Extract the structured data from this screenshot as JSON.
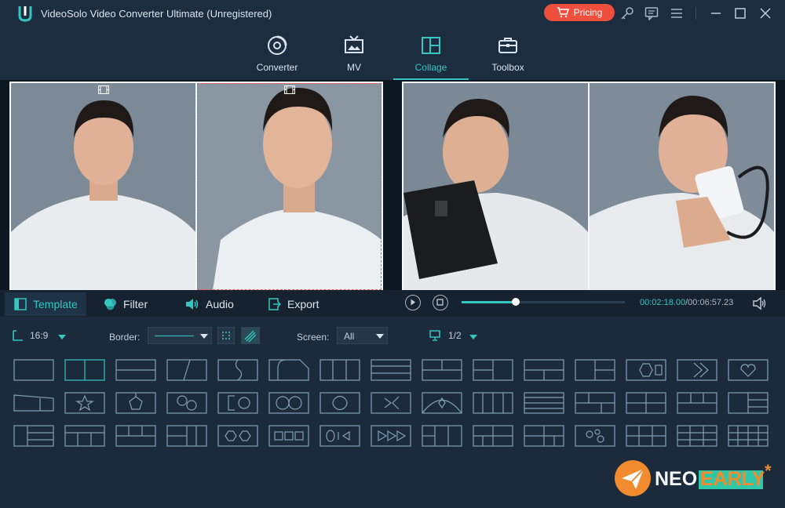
{
  "app": {
    "title": "VideoSolo Video Converter Ultimate (Unregistered)",
    "pricing_label": "Pricing"
  },
  "tabs": [
    {
      "label": "Converter",
      "icon": "converter-icon"
    },
    {
      "label": "MV",
      "icon": "mv-icon"
    },
    {
      "label": "Collage",
      "icon": "collage-icon",
      "active": true
    },
    {
      "label": "Toolbox",
      "icon": "toolbox-icon"
    }
  ],
  "controls": {
    "tabs": [
      {
        "label": "Template",
        "icon": "template-icon",
        "active": true
      },
      {
        "label": "Filter",
        "icon": "filter-icon"
      },
      {
        "label": "Audio",
        "icon": "audio-icon"
      },
      {
        "label": "Export",
        "icon": "export-icon"
      }
    ],
    "progress": 0.33,
    "current_time": "00:02:18.00",
    "total_time": "/00:06:57.23"
  },
  "options": {
    "ratio": "16:9",
    "border_label": "Border:",
    "screen_label": "Screen:",
    "screen_value": "All",
    "page": "1/2"
  },
  "watermark": {
    "text_a": "NEO",
    "text_b": "EARLY"
  },
  "colors": {
    "accent": "#35c6c2",
    "pricing": "#f04f3d",
    "background": "#1b2b3c"
  }
}
